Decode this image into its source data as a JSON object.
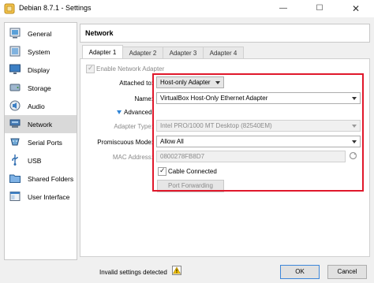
{
  "window": {
    "title": "Debian 8.7.1 - Settings",
    "controls": {
      "minimize": "—",
      "maximize": "☐",
      "close": "✕"
    }
  },
  "sidebar": {
    "items": [
      {
        "label": "General",
        "icon": "general-icon"
      },
      {
        "label": "System",
        "icon": "system-icon"
      },
      {
        "label": "Display",
        "icon": "display-icon"
      },
      {
        "label": "Storage",
        "icon": "storage-icon"
      },
      {
        "label": "Audio",
        "icon": "audio-icon"
      },
      {
        "label": "Network",
        "icon": "network-icon",
        "selected": true
      },
      {
        "label": "Serial Ports",
        "icon": "serial-ports-icon"
      },
      {
        "label": "USB",
        "icon": "usb-icon"
      },
      {
        "label": "Shared Folders",
        "icon": "shared-folders-icon"
      },
      {
        "label": "User Interface",
        "icon": "user-interface-icon"
      }
    ]
  },
  "panel": {
    "title": "Network"
  },
  "tabs": [
    {
      "label": "Adapter 1",
      "active": true
    },
    {
      "label": "Adapter 2"
    },
    {
      "label": "Adapter 3"
    },
    {
      "label": "Adapter 4"
    }
  ],
  "adapter": {
    "enable_label": "Enable Network Adapter",
    "enable_checked": true,
    "attached_label": "Attached to:",
    "attached_value": "Host-only Adapter",
    "name_label": "Name:",
    "name_value": "VirtualBox Host-Only Ethernet Adapter",
    "advanced_label": "Advanced",
    "adapter_type_label": "Adapter Type:",
    "adapter_type_value": "Intel PRO/1000 MT Desktop (82540EM)",
    "promiscuous_label": "Promiscuous Mode:",
    "promiscuous_value": "Allow All",
    "mac_label": "MAC Address:",
    "mac_value": "0800278FB8D7",
    "cable_label": "Cable Connected",
    "cable_checked": true,
    "port_forwarding_label": "Port Forwarding"
  },
  "status": {
    "text": "Invalid settings detected",
    "icon": "warning-icon"
  },
  "footer": {
    "ok_label": "OK",
    "cancel_label": "Cancel"
  },
  "colors": {
    "highlight": "#e0182b",
    "accent": "#2f84d6",
    "selected_bg": "#d9d9d9"
  }
}
